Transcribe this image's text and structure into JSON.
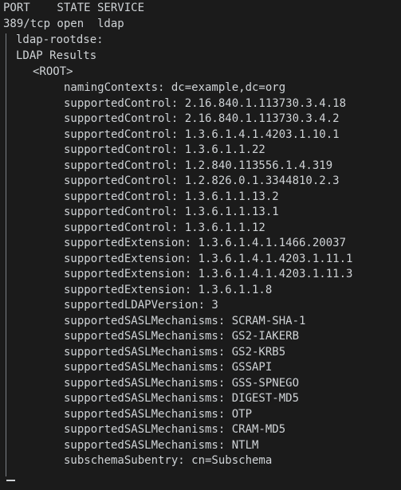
{
  "header": {
    "columns": "PORT    STATE SERVICE",
    "port_line": "389/tcp open  ldap"
  },
  "script": {
    "name": "ldap-rootdse:",
    "results_label": "LDAP Results",
    "root_label": "<ROOT>"
  },
  "entries": [
    "namingContexts: dc=example,dc=org",
    "supportedControl: 2.16.840.1.113730.3.4.18",
    "supportedControl: 2.16.840.1.113730.3.4.2",
    "supportedControl: 1.3.6.1.4.1.4203.1.10.1",
    "supportedControl: 1.3.6.1.1.22",
    "supportedControl: 1.2.840.113556.1.4.319",
    "supportedControl: 1.2.826.0.1.3344810.2.3",
    "supportedControl: 1.3.6.1.1.13.2",
    "supportedControl: 1.3.6.1.1.13.1",
    "supportedControl: 1.3.6.1.1.12",
    "supportedExtension: 1.3.6.1.4.1.1466.20037",
    "supportedExtension: 1.3.6.1.4.1.4203.1.11.1",
    "supportedExtension: 1.3.6.1.4.1.4203.1.11.3",
    "supportedExtension: 1.3.6.1.1.8",
    "supportedLDAPVersion: 3",
    "supportedSASLMechanisms: SCRAM-SHA-1",
    "supportedSASLMechanisms: GS2-IAKERB",
    "supportedSASLMechanisms: GS2-KRB5",
    "supportedSASLMechanisms: GSSAPI",
    "supportedSASLMechanisms: GSS-SPNEGO",
    "supportedSASLMechanisms: DIGEST-MD5",
    "supportedSASLMechanisms: OTP",
    "supportedSASLMechanisms: CRAM-MD5",
    "supportedSASLMechanisms: NTLM",
    "subschemaSubentry: cn=Subschema"
  ],
  "colors": {
    "background": "#1b1b1b",
    "text": "#cfd3d6",
    "tree": "#7b8085"
  }
}
